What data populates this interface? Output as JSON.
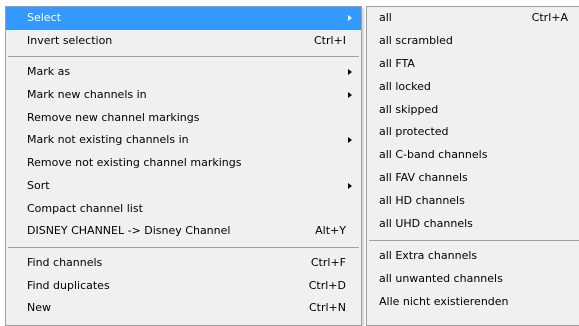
{
  "main_menu": {
    "select": "Select",
    "invert_selection": {
      "label": "Invert selection",
      "shortcut": "Ctrl+I"
    },
    "mark_as": "Mark as",
    "mark_new_channels_in": "Mark new channels in",
    "remove_new_channel_markings": "Remove new channel markings",
    "mark_not_existing_channels_in": "Mark not existing channels in",
    "remove_not_existing_channel_markings": "Remove not existing channel markings",
    "sort": "Sort",
    "compact_channel_list": "Compact channel list",
    "rename_channel": {
      "label": "DISNEY CHANNEL -> Disney Channel",
      "shortcut": "Alt+Y"
    },
    "find_channels": {
      "label": "Find channels",
      "shortcut": "Ctrl+F"
    },
    "find_duplicates": {
      "label": "Find duplicates",
      "shortcut": "Ctrl+D"
    },
    "new": {
      "label": "New",
      "shortcut": "Ctrl+N"
    }
  },
  "sub_menu": {
    "all": {
      "label": "all",
      "shortcut": "Ctrl+A"
    },
    "all_scrambled": "all scrambled",
    "all_fta": "all FTA",
    "all_locked": "all locked",
    "all_skipped": "all skipped",
    "all_protected": "all protected",
    "all_cband": "all C-band channels",
    "all_fav": "all FAV channels",
    "all_hd": "all HD channels",
    "all_uhd": "all UHD channels",
    "all_extra": "all Extra channels",
    "all_unwanted": "all unwanted channels",
    "alle_nicht_existierenden": "Alle nicht existierenden"
  },
  "colors": {
    "highlight": "#3399ff",
    "menu_bg": "#f0f0f0"
  }
}
